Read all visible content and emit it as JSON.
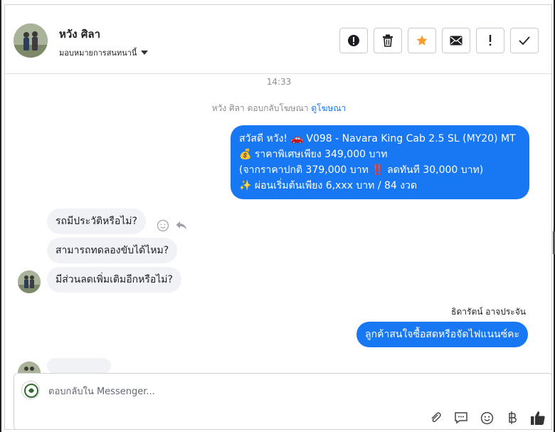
{
  "header": {
    "contact_name": "หวัง ศิลา",
    "assign_label": "มอบหมายการสนทนานี้"
  },
  "actions": [
    {
      "name": "spam-report-button",
      "icon": "alert-circle-icon"
    },
    {
      "name": "delete-button",
      "icon": "trash-icon"
    },
    {
      "name": "star-button",
      "icon": "star-icon",
      "color": "#f79b2b"
    },
    {
      "name": "mark-unread-button",
      "icon": "envelope-icon"
    },
    {
      "name": "follow-up-button",
      "icon": "exclamation-icon"
    },
    {
      "name": "mark-done-button",
      "icon": "check-icon"
    }
  ],
  "chat": {
    "timestamp": "14:33",
    "ad_notice_prefix": "หวัง ศิลา ตอบกลับโฆษณา",
    "ad_notice_link": "ดูโฆษณา",
    "ad_message": {
      "line1": "สวัสดี หวัง! 🚗 V098 - Navara King Cab 2.5 SL (MY20) MT",
      "line2": "💰 ราคาพิเศษเพียง 349,000 บาท",
      "line3": "(จากราคาปกติ 379,000 บาท ‼️ ลดทันที 30,000 บาท)",
      "line4": "✨ ผ่อนเริ่มต้นเพียง 6,xxx บาท / 84 งวด"
    },
    "incoming": [
      "รถมีประวัติหรือไม่?",
      "สามารถทดลองขับได้ไหม?",
      "มีส่วนลดเพิ่มเติมอีกหรือไม่?"
    ],
    "agent_name": "ธิดารัตน์ อาจประจัน",
    "agent_reply": "ลูกค้าสนใจซื้อสดหรือจัดไฟแนนซ์คะ"
  },
  "composer": {
    "placeholder": "ตอบกลับใน Messenger..."
  },
  "colors": {
    "outgoing": "#1877f2",
    "incoming": "#f0f2f5",
    "star": "#f79b2b"
  }
}
